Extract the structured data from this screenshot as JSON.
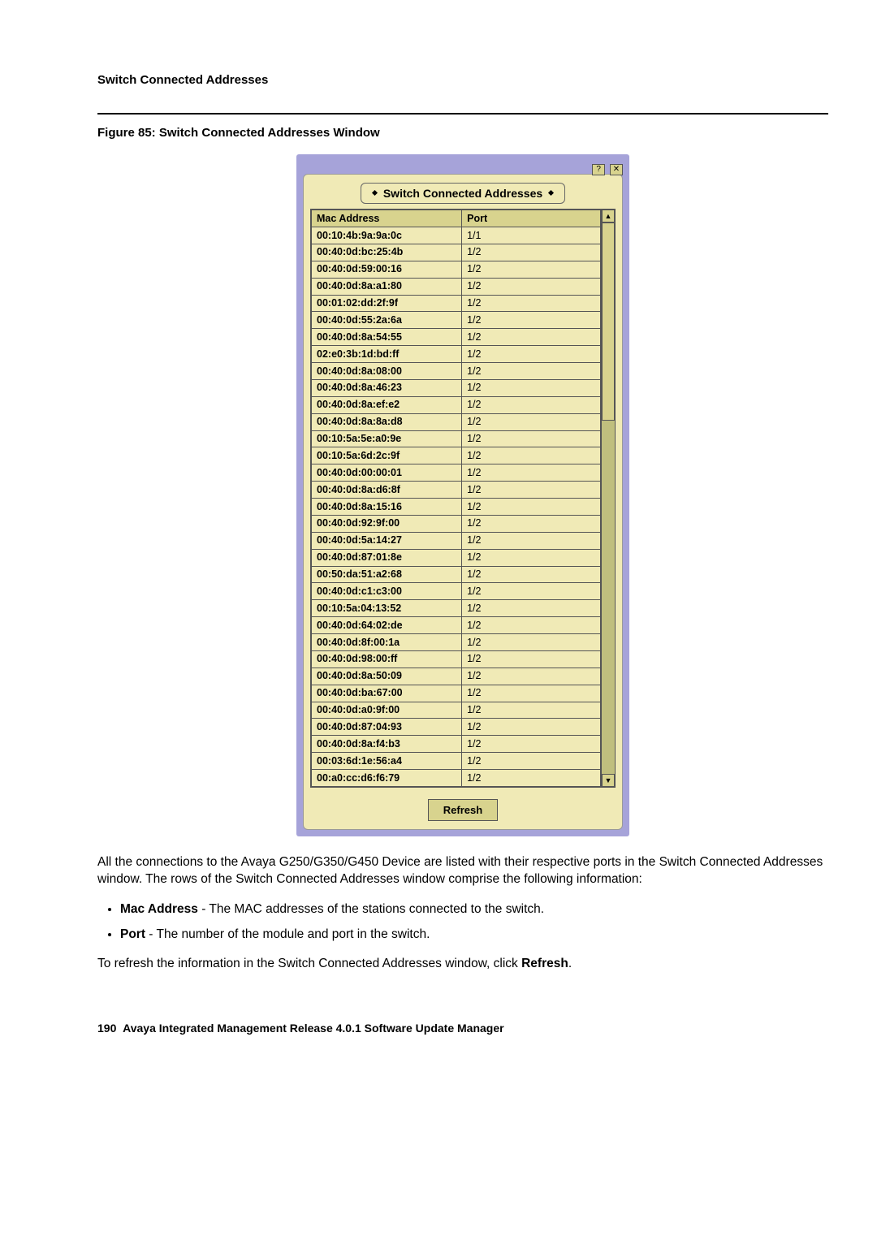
{
  "section_heading": "Switch Connected Addresses",
  "figure_caption": "Figure 85: Switch Connected Addresses Window",
  "window": {
    "title": "Switch Connected Addresses",
    "col_mac": "Mac Address",
    "col_port": "Port",
    "refresh_label": "Refresh",
    "rows": [
      {
        "mac": "00:10:4b:9a:9a:0c",
        "port": "1/1"
      },
      {
        "mac": "00:40:0d:bc:25:4b",
        "port": "1/2"
      },
      {
        "mac": "00:40:0d:59:00:16",
        "port": "1/2"
      },
      {
        "mac": "00:40:0d:8a:a1:80",
        "port": "1/2"
      },
      {
        "mac": "00:01:02:dd:2f:9f",
        "port": "1/2"
      },
      {
        "mac": "00:40:0d:55:2a:6a",
        "port": "1/2"
      },
      {
        "mac": "00:40:0d:8a:54:55",
        "port": "1/2"
      },
      {
        "mac": "02:e0:3b:1d:bd:ff",
        "port": "1/2"
      },
      {
        "mac": "00:40:0d:8a:08:00",
        "port": "1/2"
      },
      {
        "mac": "00:40:0d:8a:46:23",
        "port": "1/2"
      },
      {
        "mac": "00:40:0d:8a:ef:e2",
        "port": "1/2"
      },
      {
        "mac": "00:40:0d:8a:8a:d8",
        "port": "1/2"
      },
      {
        "mac": "00:10:5a:5e:a0:9e",
        "port": "1/2"
      },
      {
        "mac": "00:10:5a:6d:2c:9f",
        "port": "1/2"
      },
      {
        "mac": "00:40:0d:00:00:01",
        "port": "1/2"
      },
      {
        "mac": "00:40:0d:8a:d6:8f",
        "port": "1/2"
      },
      {
        "mac": "00:40:0d:8a:15:16",
        "port": "1/2"
      },
      {
        "mac": "00:40:0d:92:9f:00",
        "port": "1/2"
      },
      {
        "mac": "00:40:0d:5a:14:27",
        "port": "1/2"
      },
      {
        "mac": "00:40:0d:87:01:8e",
        "port": "1/2"
      },
      {
        "mac": "00:50:da:51:a2:68",
        "port": "1/2"
      },
      {
        "mac": "00:40:0d:c1:c3:00",
        "port": "1/2"
      },
      {
        "mac": "00:10:5a:04:13:52",
        "port": "1/2"
      },
      {
        "mac": "00:40:0d:64:02:de",
        "port": "1/2"
      },
      {
        "mac": "00:40:0d:8f:00:1a",
        "port": "1/2"
      },
      {
        "mac": "00:40:0d:98:00:ff",
        "port": "1/2"
      },
      {
        "mac": "00:40:0d:8a:50:09",
        "port": "1/2"
      },
      {
        "mac": "00:40:0d:ba:67:00",
        "port": "1/2"
      },
      {
        "mac": "00:40:0d:a0:9f:00",
        "port": "1/2"
      },
      {
        "mac": "00:40:0d:87:04:93",
        "port": "1/2"
      },
      {
        "mac": "00:40:0d:8a:f4:b3",
        "port": "1/2"
      },
      {
        "mac": "00:03:6d:1e:56:a4",
        "port": "1/2"
      },
      {
        "mac": "00:a0:cc:d6:f6:79",
        "port": "1/2"
      }
    ]
  },
  "body_para_1": "All the connections to the Avaya G250/G350/G450 Device are listed with their respective ports in the Switch Connected Addresses window. The rows of the Switch Connected Addresses window comprise the following information:",
  "bullets": [
    {
      "term": "Mac Address",
      "desc": " - The MAC addresses of the stations connected to the switch."
    },
    {
      "term": "Port",
      "desc": " - The number of the module and port in the switch."
    }
  ],
  "body_para_2_pre": "To refresh the information in the Switch Connected Addresses window, click ",
  "body_para_2_bold": "Refresh",
  "body_para_2_post": ".",
  "page_number": "190",
  "footer_text": "Avaya Integrated Management Release 4.0.1 Software Update Manager"
}
